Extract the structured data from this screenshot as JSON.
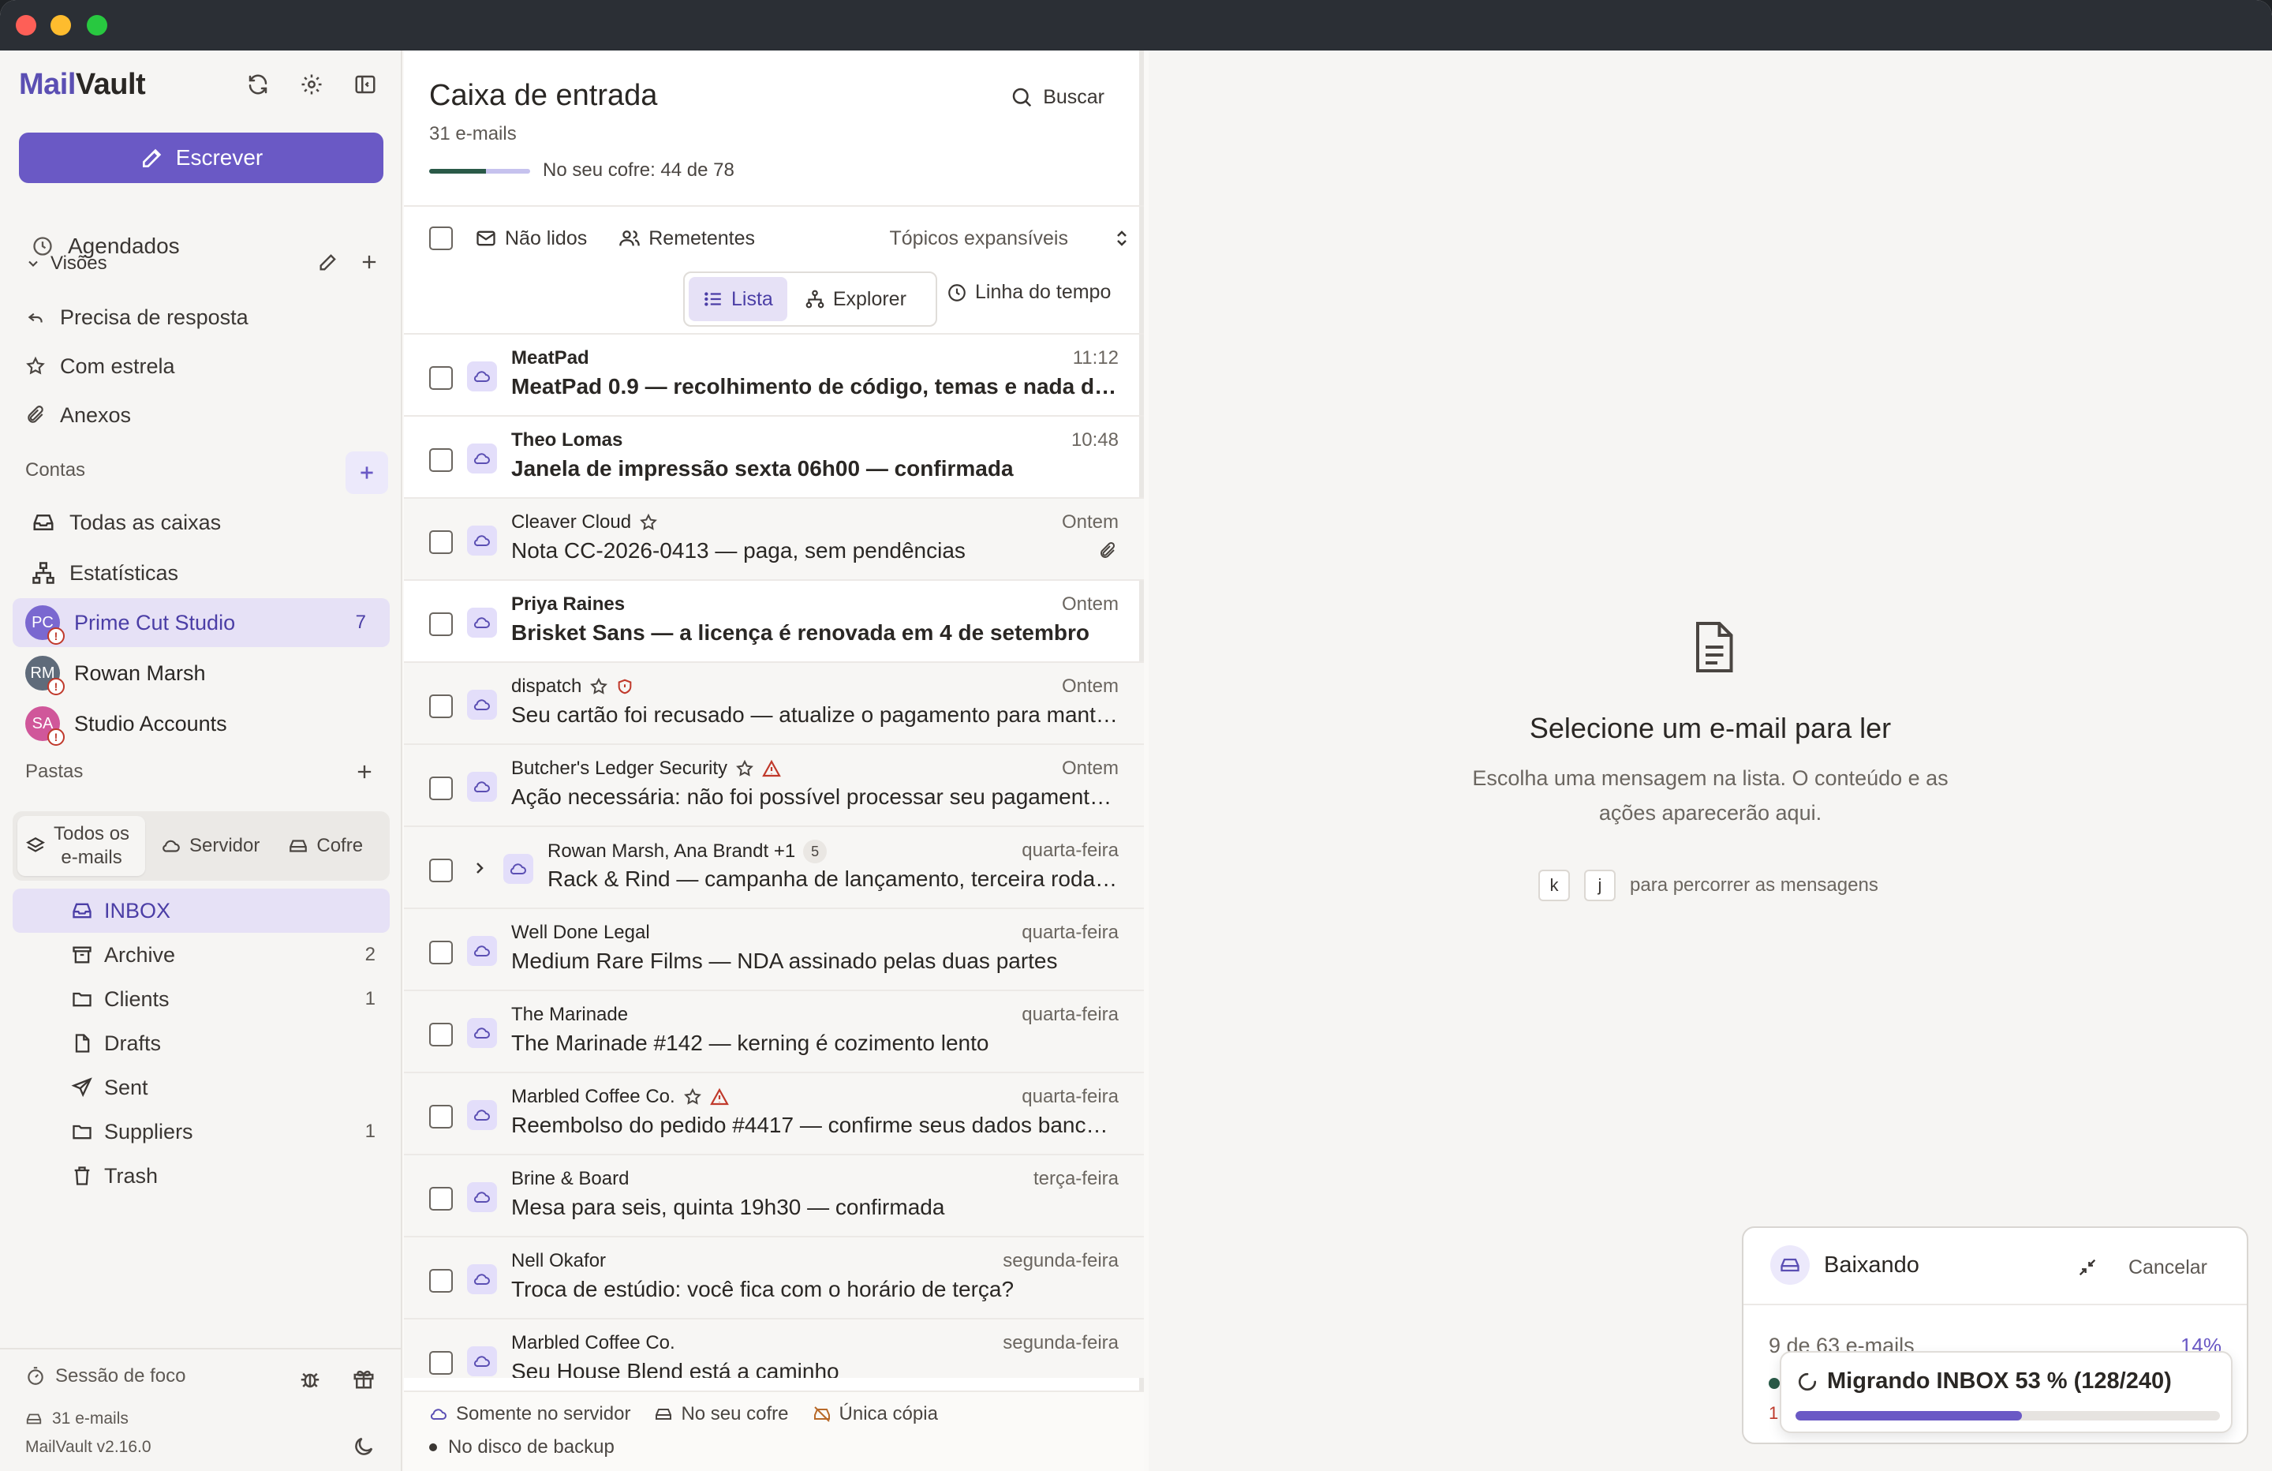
{
  "app": {
    "brand_part1": "Mail",
    "brand_part2": "Vault",
    "compose_label": "Escrever",
    "accent_color": "#6a59c5"
  },
  "sidebar": {
    "scheduled": "Agendados",
    "views_title": "Visões",
    "views": [
      {
        "label": "Precisa de resposta",
        "icon": "reply-icon"
      },
      {
        "label": "Com estrela",
        "icon": "star-icon"
      },
      {
        "label": "Anexos",
        "icon": "paperclip-icon"
      }
    ],
    "accounts_title": "Contas",
    "all_inboxes": "Todas as caixas",
    "stats": "Estatísticas",
    "accounts": [
      {
        "name": "Prime Cut Studio",
        "initials": "PC",
        "count": "7",
        "color": "#7a68d0",
        "active": true
      },
      {
        "name": "Rowan Marsh",
        "initials": "RM",
        "count": "",
        "color": "#5f6b7a",
        "active": false
      },
      {
        "name": "Studio Accounts",
        "initials": "SA",
        "count": "",
        "color": "#d0579a",
        "active": false
      }
    ],
    "folders_title": "Pastas",
    "folder_scope": [
      {
        "label": "Todos os\ne-mails",
        "icon": "layers-icon"
      },
      {
        "label": "Servidor",
        "icon": "cloud-icon"
      },
      {
        "label": "Cofre",
        "icon": "vault-icon"
      }
    ],
    "folders": [
      {
        "label": "INBOX",
        "count": "",
        "icon": "inbox-icon",
        "active": true
      },
      {
        "label": "Archive",
        "count": "2",
        "icon": "archive-icon"
      },
      {
        "label": "Clients",
        "count": "1",
        "icon": "folder-icon"
      },
      {
        "label": "Drafts",
        "count": "",
        "icon": "file-icon"
      },
      {
        "label": "Sent",
        "count": "",
        "icon": "send-icon"
      },
      {
        "label": "Suppliers",
        "count": "1",
        "icon": "folder-icon"
      },
      {
        "label": "Trash",
        "count": "",
        "icon": "trash-icon"
      }
    ],
    "focus_session": "Sessão de foco",
    "email_count": "31 e-mails",
    "version": "MailVault v2.16.0"
  },
  "inbox": {
    "title": "Caixa de entrada",
    "count": "31 e-mails",
    "vault_text": "No seu cofre: 44 de 78",
    "vault_fraction": 0.564,
    "search_label": "Buscar",
    "filters": {
      "unread": "Não lidos",
      "senders": "Remetentes",
      "topics": "Tópicos expansíveis"
    },
    "views": {
      "list": "Lista",
      "explorer": "Explorer",
      "timeline": "Linha do tempo"
    },
    "messages": [
      {
        "sender": "MeatPad",
        "subject": "MeatPad 0.9 — recolhimento de código, temas e nada de …",
        "time": "11:12",
        "unread": true
      },
      {
        "sender": "Theo Lomas",
        "subject": "Janela de impressão sexta 06h00 — confirmada",
        "time": "10:48",
        "unread": true
      },
      {
        "sender": "Cleaver Cloud",
        "subject": "Nota CC-2026-0413 — paga, sem pendências",
        "time": "Ontem",
        "unread": false,
        "star": true,
        "attachment": true
      },
      {
        "sender": "Priya Raines",
        "subject": "Brisket Sans — a licença é renovada em 4 de setembro",
        "time": "Ontem",
        "unread": true
      },
      {
        "sender": "dispatch",
        "subject": "Seu cartão foi recusado — atualize o pagamento para mant…",
        "time": "Ontem",
        "unread": false,
        "star": true,
        "shield": true
      },
      {
        "sender": "Butcher's Ledger Security",
        "subject": "Ação necessária: não foi possível processar seu pagament…",
        "time": "Ontem",
        "unread": false,
        "star": true,
        "warning": true
      },
      {
        "sender": "Rowan Marsh, Ana Brandt +1",
        "subject": "Rack & Rind — campanha de lançamento, terceira roda…",
        "time": "quarta-feira",
        "unread": false,
        "thread_count": "5"
      },
      {
        "sender": "Well Done Legal",
        "subject": "Medium Rare Films — NDA assinado pelas duas partes",
        "time": "quarta-feira",
        "unread": false
      },
      {
        "sender": "The Marinade",
        "subject": "The Marinade #142 — kerning é cozimento lento",
        "time": "quarta-feira",
        "unread": false
      },
      {
        "sender": "Marbled Coffee Co.",
        "subject": "Reembolso do pedido #4417 — confirme seus dados bancá…",
        "time": "quarta-feira",
        "unread": false,
        "star": true,
        "warning": true
      },
      {
        "sender": "Brine & Board",
        "subject": "Mesa para seis, quinta 19h30 — confirmada",
        "time": "terça-feira",
        "unread": false
      },
      {
        "sender": "Nell Okafor",
        "subject": "Troca de estúdio: você fica com o horário de terça?",
        "time": "segunda-feira",
        "unread": false
      },
      {
        "sender": "Marbled Coffee Co.",
        "subject": "Seu House Blend está a caminho",
        "time": "segunda-feira",
        "unread": false
      }
    ],
    "legend": {
      "server_only": "Somente no servidor",
      "in_vault": "No seu cofre",
      "single_copy": "Única cópia",
      "backup_disk": "No disco de backup"
    }
  },
  "reading": {
    "empty_title": "Selecione um e-mail para ler",
    "empty_sub": "Escolha uma mensagem na lista. O conteúdo e as ações aparecerão aqui.",
    "key1": "k",
    "key2": "j",
    "key_hint": "para percorrer as mensagens"
  },
  "download": {
    "title": "Baixando",
    "cancel": "Cancelar",
    "progress_text": "9 de 63 e-mails",
    "percent": "14%",
    "stray_digit": "1",
    "migrate_text": "Migrando INBOX 53 % (128/240)",
    "migrate_fraction": 0.533
  }
}
